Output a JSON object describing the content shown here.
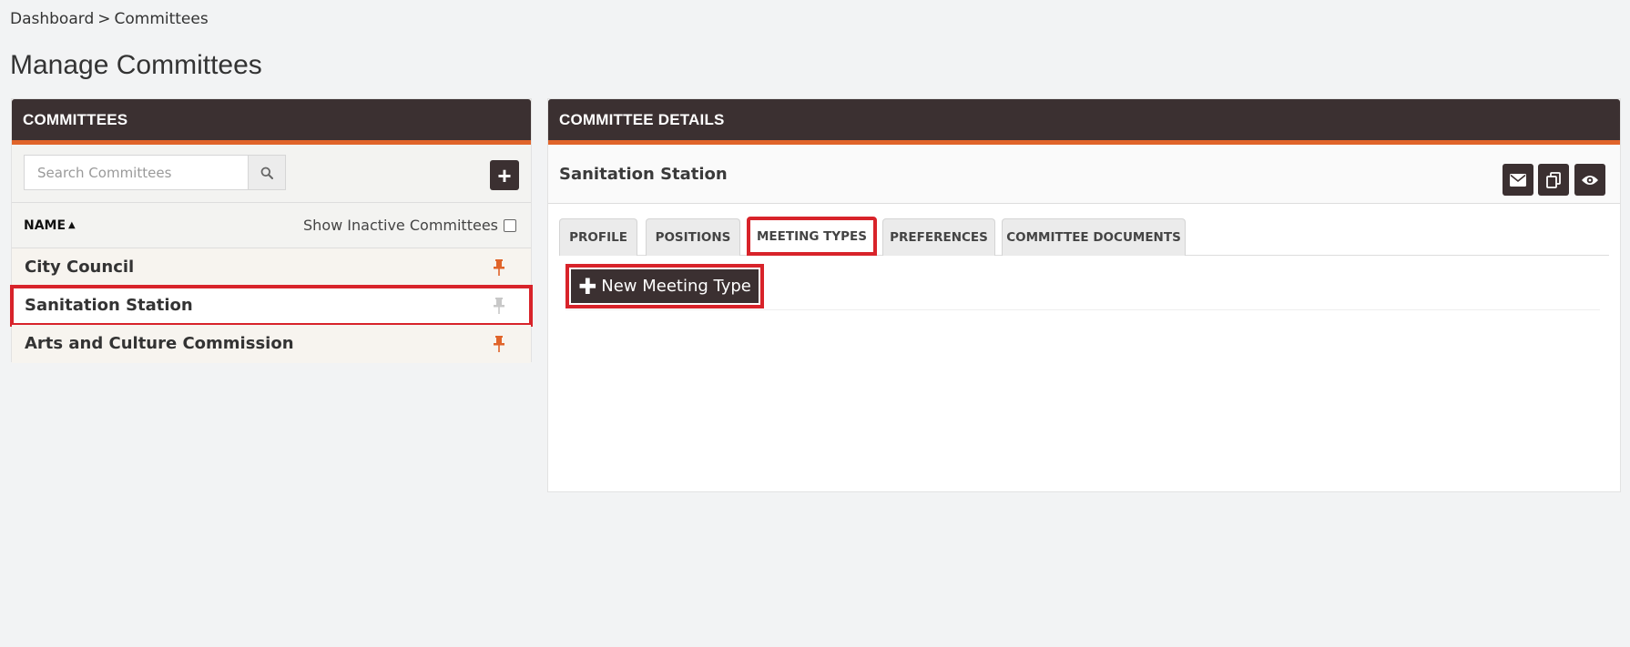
{
  "breadcrumb": {
    "home": "Dashboard",
    "separator": ">",
    "current": "Committees"
  },
  "page": {
    "title": "Manage Committees"
  },
  "committees_panel": {
    "header": "COMMITTEES",
    "search_placeholder": "Search Committees",
    "add_label": "+",
    "column_name": "NAME",
    "show_inactive_label": "Show Inactive Committees",
    "items": [
      {
        "name": "City Council",
        "pinned": true
      },
      {
        "name": "Sanitation Station",
        "pinned": false,
        "selected": true
      },
      {
        "name": "Arts and Culture Commission",
        "pinned": true
      }
    ]
  },
  "details_panel": {
    "header": "COMMITTEE DETAILS",
    "committee_name": "Sanitation Station",
    "tabs": [
      {
        "label": "PROFILE"
      },
      {
        "label": "POSITIONS"
      },
      {
        "label": "MEETING TYPES",
        "active": true
      },
      {
        "label": "PREFERENCES"
      },
      {
        "label": "COMMITTEE DOCUMENTS"
      }
    ],
    "new_meeting_type_label": "New Meeting Type",
    "action_icons": [
      "envelope-icon",
      "copy-icon",
      "eye-icon"
    ]
  },
  "colors": {
    "header_bg": "#3b3031",
    "header_accent": "#e0642a",
    "highlight": "#d8232a",
    "pin_active": "#e0642a",
    "pin_inactive": "#c8c8c8"
  }
}
